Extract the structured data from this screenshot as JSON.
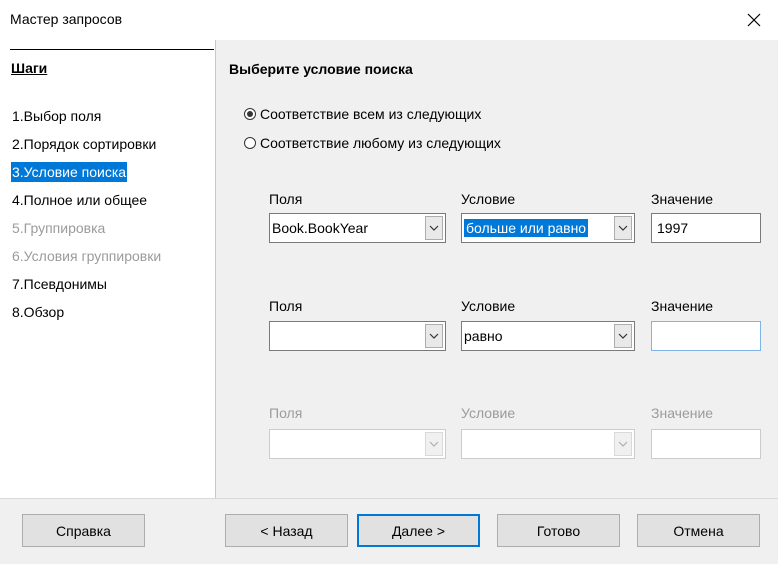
{
  "window": {
    "title": "Мастер запросов"
  },
  "sidebar": {
    "heading": "Шаги",
    "steps": [
      {
        "label": "1.Выбор поля"
      },
      {
        "label": "2.Порядок сортировки"
      },
      {
        "label": "3.Условие поиска"
      },
      {
        "label": "4.Полное или общее"
      },
      {
        "label": "5.Группировка"
      },
      {
        "label": "6.Условия группировки"
      },
      {
        "label": "7.Псевдонимы"
      },
      {
        "label": "8.Обзор"
      }
    ]
  },
  "main": {
    "title": "Выберите условие поиска",
    "radio_all": "Соответствие всем из следующих",
    "radio_any": "Соответствие любому из следующих",
    "rows": [
      {
        "fields_label": "Поля",
        "condition_label": "Условие",
        "value_label": "Значение",
        "field": "Book.BookYear",
        "condition": "больше или равно",
        "value": "1997"
      },
      {
        "fields_label": "Поля",
        "condition_label": "Условие",
        "value_label": "Значение",
        "field": "",
        "condition": "равно",
        "value": ""
      },
      {
        "fields_label": "Поля",
        "condition_label": "Условие",
        "value_label": "Значение",
        "field": "",
        "condition": "",
        "value": ""
      }
    ]
  },
  "footer": {
    "help": "Справка",
    "back": "< Назад",
    "next": "Далее >",
    "finish": "Готово",
    "cancel": "Отмена"
  }
}
